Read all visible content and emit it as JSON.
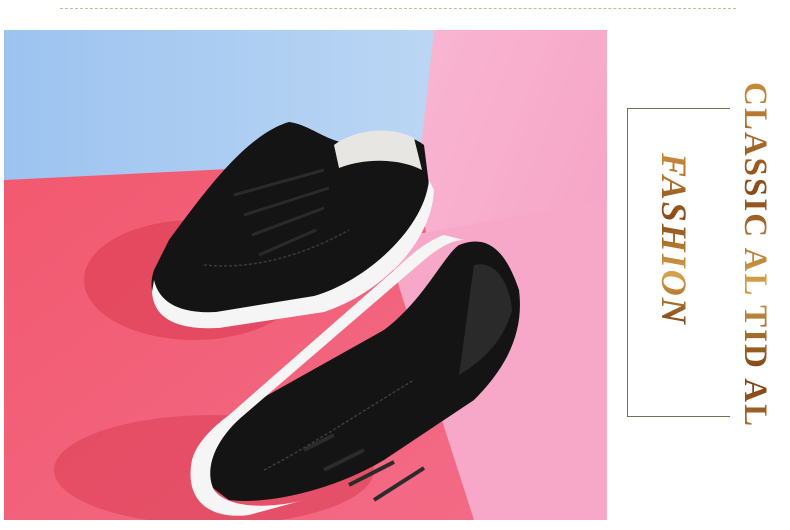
{
  "banner": {
    "headline": "CLASSIC AL TID AL",
    "subheadline": "FASHION"
  },
  "photo": {
    "subject": "sneakers-photo",
    "colors": {
      "sky_blue": "#a9cdf2",
      "coral_red": "#f4566a",
      "pink": "#f6a9c9",
      "shoe_black": "#141414",
      "sole_white": "#f7f7f7",
      "gold": "#b87530"
    }
  }
}
